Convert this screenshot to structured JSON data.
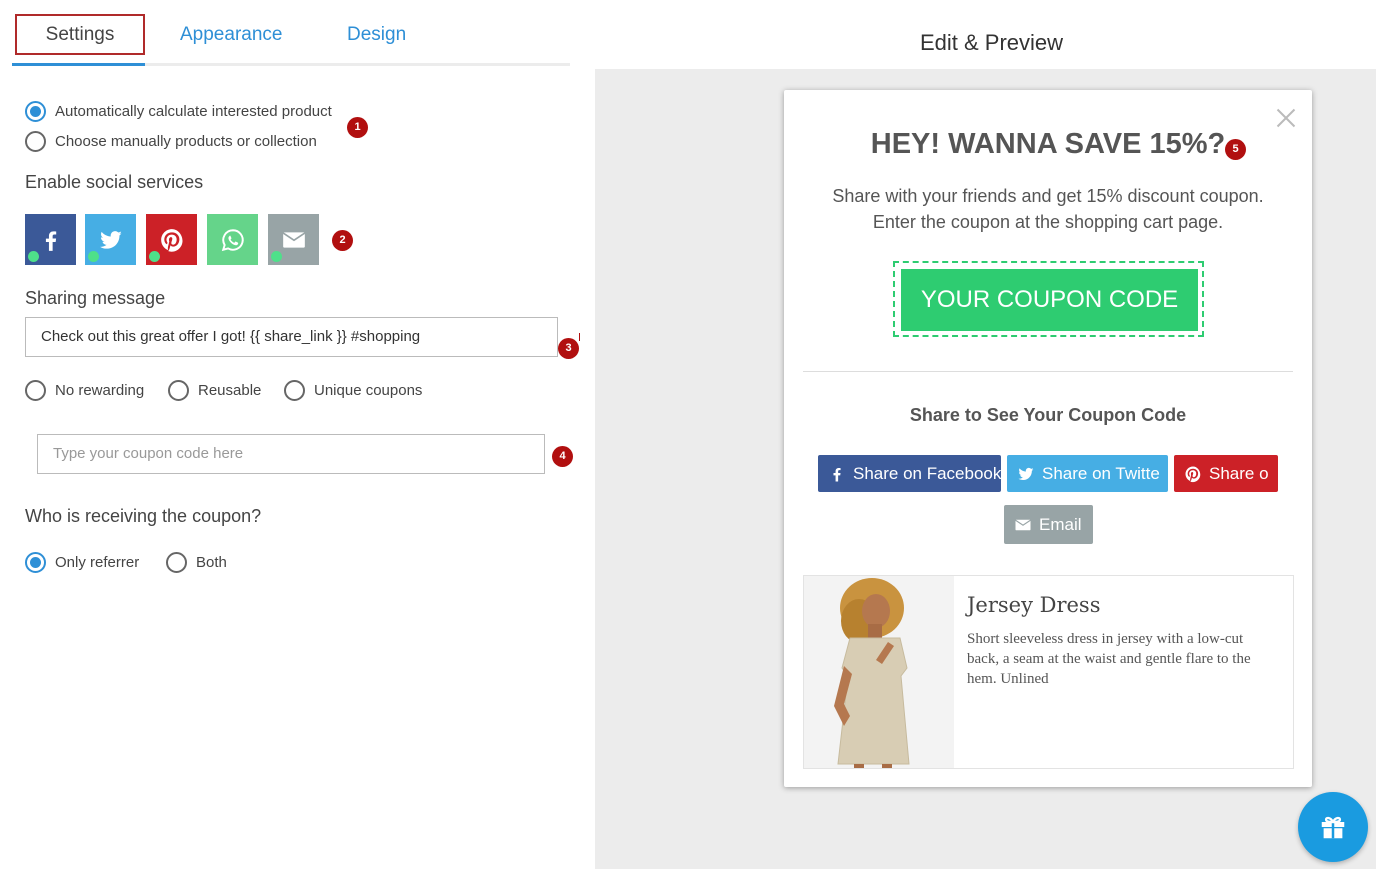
{
  "tabs": [
    {
      "label": "Settings"
    },
    {
      "label": "Appearance"
    },
    {
      "label": "Design"
    }
  ],
  "product_options": [
    {
      "label": "Automatically calculate interested product",
      "checked": true
    },
    {
      "label": "Choose manually products or collection",
      "checked": false
    }
  ],
  "badges": [
    "1",
    "2",
    "3",
    "4",
    "5"
  ],
  "social": {
    "title": "Enable social services",
    "services": [
      {
        "icon": "facebook-icon",
        "color": "#3b5998",
        "enabled": true
      },
      {
        "icon": "twitter-icon",
        "color": "#46aee4",
        "enabled": true
      },
      {
        "icon": "pinterest-icon",
        "color": "#cc2127",
        "enabled": true
      },
      {
        "icon": "whatsapp-icon",
        "color": "#65d48a",
        "enabled": false
      },
      {
        "icon": "email-icon",
        "color": "#98a4a6",
        "enabled": true
      }
    ]
  },
  "sharing": {
    "title": "Sharing message",
    "message": "Check out this great offer I got! {{ share_link }} #shopping"
  },
  "reward_options": [
    {
      "label": "No rewarding",
      "checked": false
    },
    {
      "label": "Reusable",
      "checked": false
    },
    {
      "label": "Unique coupons",
      "checked": false
    }
  ],
  "coupon_input": {
    "placeholder": "Type your coupon code here"
  },
  "receiver": {
    "title": "Who is receiving the coupon?",
    "options": [
      {
        "label": "Only referrer",
        "checked": true
      },
      {
        "label": "Both",
        "checked": false
      }
    ]
  },
  "preview": {
    "title": "Edit & Preview",
    "headline": "HEY! WANNA SAVE 15%?",
    "subline_1": "Share with your friends and get 15% discount coupon.",
    "subline_2": "Enter the coupon at the shopping cart page.",
    "coupon": "YOUR COUPON CODE",
    "share_title": "Share to See Your Coupon Code",
    "share_buttons": {
      "facebook": "Share on Facebook",
      "twitter": "Share on Twitte",
      "pinterest": "Share o",
      "email": "Email"
    },
    "product": {
      "name": "Jersey Dress",
      "description": "Short sleeveless dress in jersey with a low-cut back, a seam at the waist and gentle flare to the hem. Unlined"
    }
  },
  "colors": {
    "accent": "#2e8fd6",
    "coupon_green": "#2ecc71",
    "badge_red": "#b10f0f",
    "fab_blue": "#1a9be0"
  }
}
